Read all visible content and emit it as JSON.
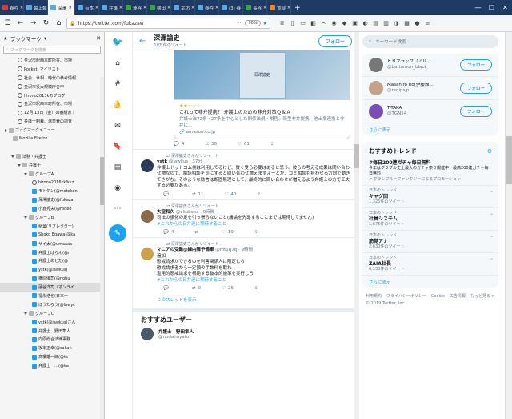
{
  "tabs": [
    {
      "label": "春吟",
      "fav": "red"
    },
    {
      "label": "最上類",
      "fav": "blue"
    },
    {
      "label": "深澤",
      "fav": "blue",
      "active": true
    },
    {
      "label": "有本",
      "fav": "blue"
    },
    {
      "label": "弁護",
      "fav": "blue"
    },
    {
      "label": "蓮谷",
      "fav": "green"
    },
    {
      "label": "横田",
      "fav": "green"
    },
    {
      "label": "幸坊",
      "fav": "blue"
    },
    {
      "label": "春吟",
      "fav": "blue"
    },
    {
      "label": "(3) 春",
      "fav": "blue"
    },
    {
      "label": "長谷",
      "fav": "green"
    },
    {
      "label": "寛部",
      "fav": "orange"
    }
  ],
  "nav": {
    "url": "https://twitter.com/fukazaw",
    "zoom": "90%"
  },
  "bookmarks": {
    "title": "ブックマーク",
    "search_placeholder": "ブックマークを検索",
    "items": [
      {
        "label": "金沢市駅西本町所在、市場",
        "icon": "globe",
        "indent": 22
      },
      {
        "label": "Pocket: マイリスト",
        "icon": "globe",
        "indent": 22
      },
      {
        "label": "社会・世相・時代の参考情報",
        "icon": "globe",
        "indent": 22
      },
      {
        "label": "金沢市役大規模庁舎申",
        "icon": "globe",
        "indent": 22
      },
      {
        "label": "hirono2013kのブログ",
        "icon": "globe",
        "indent": 22
      },
      {
        "label": "金沢市駅西本町所在、市場",
        "icon": "globe",
        "indent": 22
      },
      {
        "label": "12月 13日（金）の番組表｜",
        "icon": "globe",
        "indent": 22
      },
      {
        "label": "弁護士制裁、選挙費の調査",
        "icon": "globe",
        "indent": 22
      },
      {
        "label": "ブックマークメニュー",
        "icon": "folder",
        "indent": 6,
        "arrow": "closed"
      },
      {
        "label": "Mozilla Firefox",
        "icon": "folder",
        "indent": 16
      },
      {
        "label": "",
        "icon": "none",
        "indent": 16
      },
      {
        "label": "法務・弁護士",
        "icon": "folder",
        "indent": 14,
        "arrow": "open"
      },
      {
        "label": "弁護士",
        "icon": "folder",
        "indent": 22,
        "arrow": "open"
      },
      {
        "label": "グループA",
        "icon": "folder",
        "indent": 30,
        "arrow": "open"
      },
      {
        "label": "hirono2016kk/kkz",
        "icon": "globe",
        "indent": 40
      },
      {
        "label": "モトケン(@motoken",
        "icon": "tw",
        "indent": 40
      },
      {
        "label": "深澤諭史(@fukaza",
        "icon": "tw",
        "indent": 40
      },
      {
        "label": "小倉秀夫(@Hideo",
        "icon": "tw",
        "indent": 40
      },
      {
        "label": "グループB",
        "icon": "folder",
        "indent": 30,
        "arrow": "open"
      },
      {
        "label": "稲葉(リフレクター)",
        "icon": "tw",
        "indent": 40
      },
      {
        "label": "Shoko Egawa(@ka",
        "icon": "tw",
        "indent": 40
      },
      {
        "label": "サイ太(@umaaaa",
        "icon": "tw",
        "indent": 40
      },
      {
        "label": "弁護士ぱらん(@n",
        "icon": "tw",
        "indent": 40
      },
      {
        "label": "弁護士あとだ(@",
        "icon": "tw",
        "indent": 40
      },
      {
        "label": "ystk(@iawkus)",
        "icon": "tw",
        "indent": 40
      },
      {
        "label": "横原優司(@nobu",
        "icon": "tw",
        "indent": 40
      },
      {
        "label": "蓮谷洋司（オンライ",
        "icon": "tw",
        "indent": 40,
        "sel": true
      },
      {
        "label": "福永浩也(日本一",
        "icon": "tw",
        "indent": 40
      },
      {
        "label": "ほうたろう(@lawyc",
        "icon": "tw",
        "indent": 40
      },
      {
        "label": "グループC",
        "icon": "folder",
        "indent": 30,
        "arrow": "open"
      },
      {
        "label": "ystk(@iawkus)さん",
        "icon": "tw",
        "indent": 40
      },
      {
        "label": "弁護士　野田隼人",
        "icon": "tw",
        "indent": 40
      },
      {
        "label": "向原総合法律事務",
        "icon": "tw",
        "indent": 40
      },
      {
        "label": "坂本正幸(@sakan",
        "icon": "tw",
        "indent": 40
      },
      {
        "label": "高橋雄一郎(@ta",
        "icon": "tw",
        "indent": 40
      },
      {
        "label": "弁護士　…(@ka",
        "icon": "tw",
        "indent": 40
      }
    ]
  },
  "header": {
    "name": "深澤諭史",
    "tweet_count": "10万件のツイート",
    "follow_label": "フォロー"
  },
  "card": {
    "book_text": "深澤諭史",
    "title": "これって非弁提携？ 弁護士のための非弁対策Ｑ＆Ａ",
    "desc": "弁護士法72条・27条を中心とした関係法規・規程、新型非弁提携、他士業連携と非弁に…",
    "url": "amazon.co.jp",
    "stars": "★★☆☆☆"
  },
  "tweet0_actions": {
    "reply": "4",
    "rt": "36",
    "like": "61"
  },
  "tweets": [
    {
      "rt": "深澤諭史さんがリツイート",
      "name": "ystk",
      "handle": "@iawkus · 37分",
      "avatar": "#2a3a5a",
      "text": "弁護士ドットコム側は利用してるけど、質く受ら必要はあると思う。彼らの考える成果は問い合わせ増なので、電話相談を司にすると問い合わせ増えますよーとか、ゴミ相談も拾わせる方向で動きてきがち。そのような勧言は断固無理として、最終的に問い合わせが増えるよう弁護士の方で工夫する必要がある。",
      "link": "",
      "actions": {
        "reply": "",
        "rt": "11",
        "like": "40"
      }
    },
    {
      "rt": "深澤諭史さんがリツイート",
      "name": "大窪和久",
      "handle": "@okuboka · 9時間",
      "avatar": "#8a6a4a",
      "text": "司法の讃化の足を引っ張らないこと(議論を先導することまでは期待してません)",
      "link": "#これからの日弁連に期待すること",
      "actions": {
        "reply": "4",
        "rt": "",
        "like": "19"
      }
    },
    {
      "rt": "深澤諭史さんがリツイート",
      "name": "マニアの受難@緑内障予備軍",
      "handle": "@mt1q7q · 9時間",
      "avatar": "#c9a24a",
      "text": "追加\n懲戒請求ができるのを利害関係人に限定しろ\n懲戒請求者から一定額の手数料を取れ\n濫用的懲戒請求を根絶する抜本的施策を実行しろ",
      "link": "#これからの日弁連に期待すること",
      "actions": {
        "reply": "",
        "rt": "9",
        "like": "26"
      }
    }
  ],
  "thread_label": "このスレッドを表示",
  "recommend": {
    "title": "おすすめユーザー",
    "name": "弁護士　野田隼人",
    "handle": "@nodahayato"
  },
  "right": {
    "search_placeholder": "キーワード検索",
    "users": [
      {
        "name": "ＫＢブラック（アル…",
        "handle": "@battamon_black",
        "avatar": "#777"
      },
      {
        "name": "Masahiro Ito(伊藤雅…",
        "handle": "@redipsjp",
        "avatar": "#c5a38a"
      },
      {
        "name": "T-TAKA",
        "handle": "@TGN54",
        "avatar": "#7a4fb5"
      }
    ],
    "follow_label": "フォロー",
    "more_label": "さらに表示",
    "trends_title": "おすすめトレンド",
    "promo": {
      "tag": "#毎日200連ガチャ毎日無料",
      "desc": "今年はグラブル史上最大のガチャ祭り開催中！最高200連ガチャ毎日無料！",
      "by": "グランブルーファンタジーによるプロモーション"
    },
    "trends": [
      {
        "cat": "日本のトレンド",
        "t": "キャグ回",
        "c": "1,325件のツイート"
      },
      {
        "cat": "日本のトレンド",
        "t": "社員システム",
        "c": "1,676件のツイート"
      },
      {
        "cat": "日本のトレンド",
        "t": "筋覚アナ",
        "c": "2,630件のツイート"
      },
      {
        "cat": "日本のトレンド",
        "t": "ZAIA社長",
        "c": "6,130件のツイート"
      }
    ],
    "trends_more": "さらに表示",
    "footer": [
      "利用規約",
      "プライバシーポリシー",
      "Cookie",
      "広告情報",
      "もっと見る ▾",
      "© 2019 Twitter, Inc."
    ]
  }
}
